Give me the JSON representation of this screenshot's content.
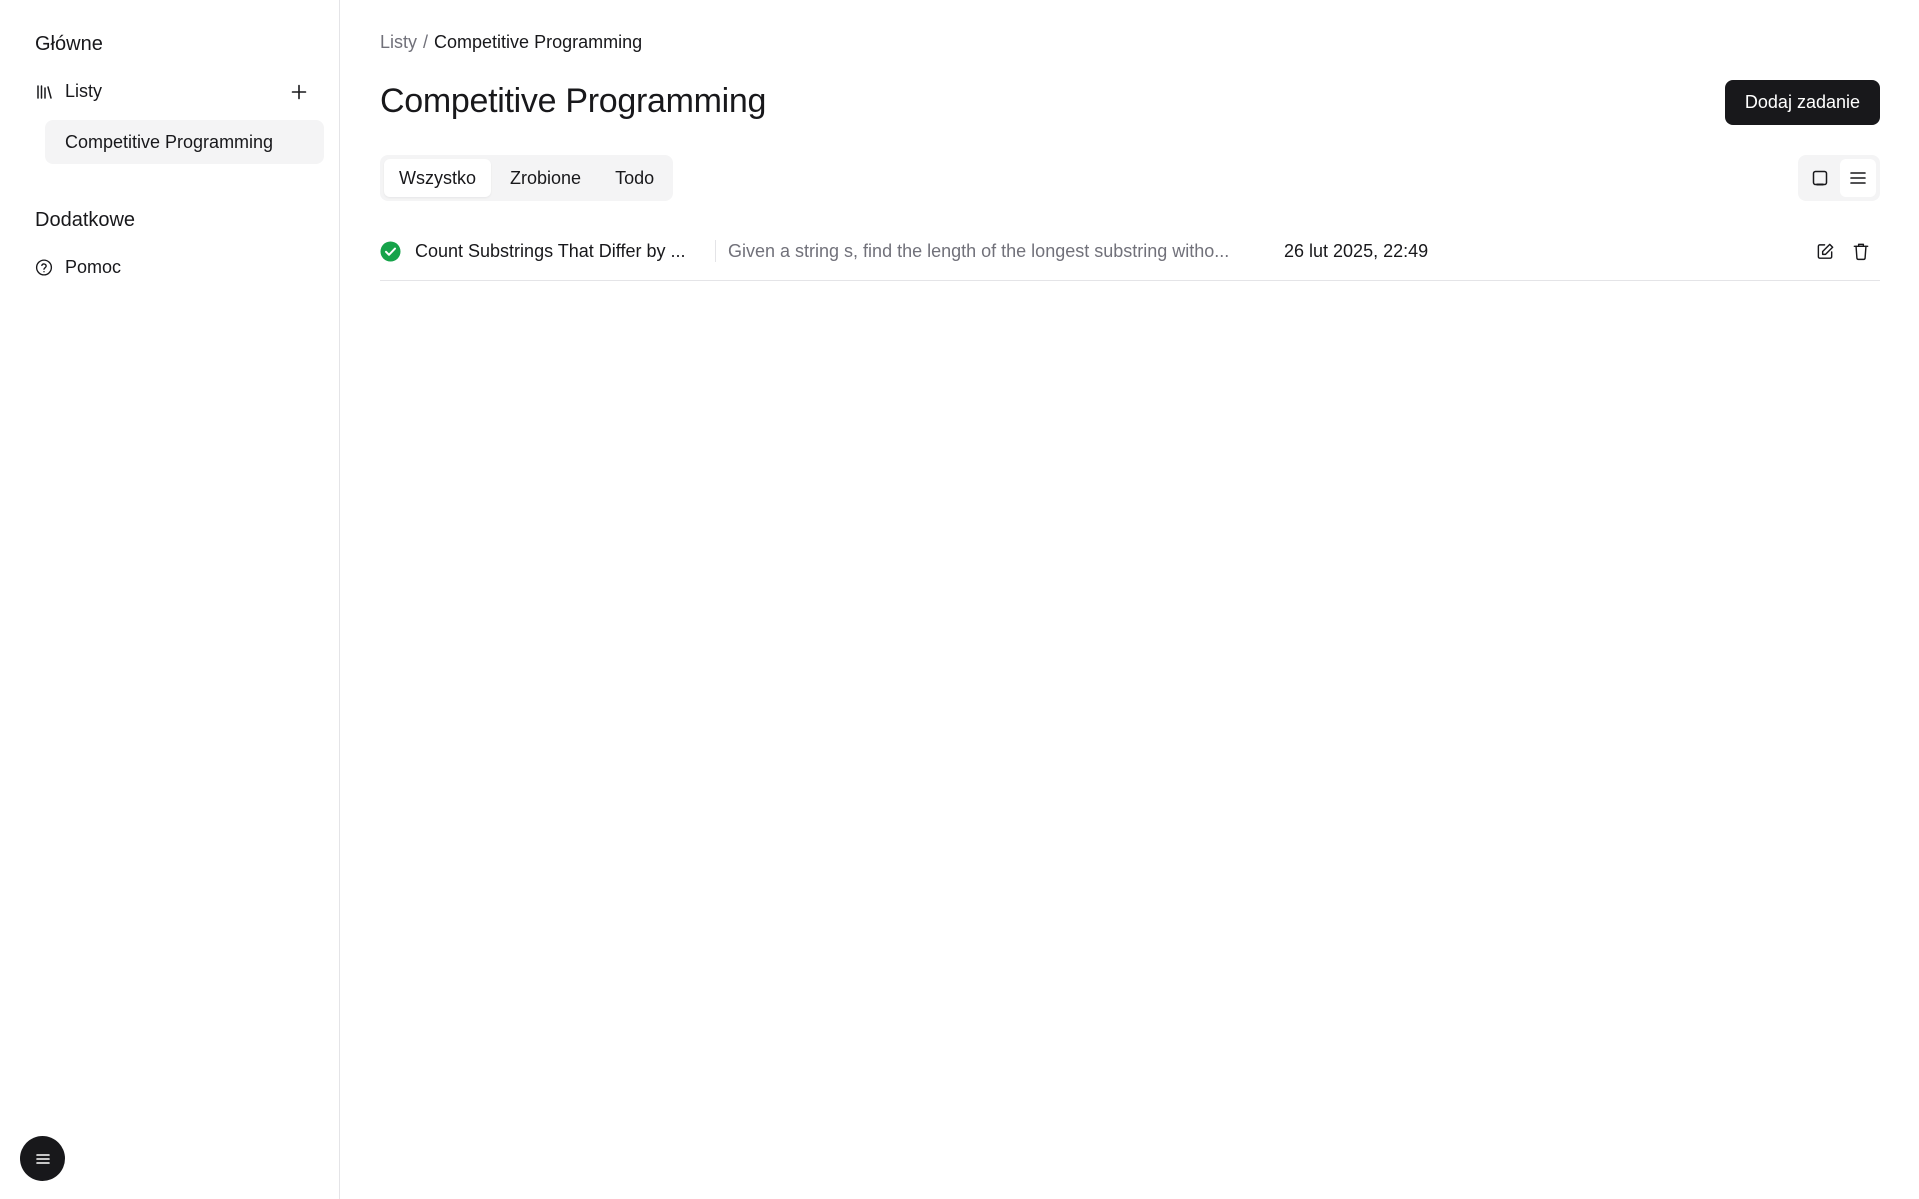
{
  "sidebar": {
    "main_section_title": "Główne",
    "lists_label": "Listy",
    "lists": [
      {
        "label": "Competitive Programming"
      }
    ],
    "extra_section_title": "Dodatkowe",
    "help_label": "Pomoc"
  },
  "breadcrumb": {
    "root": "Listy",
    "separator": "/",
    "current": "Competitive Programming"
  },
  "header": {
    "title": "Competitive Programming",
    "add_task_label": "Dodaj zadanie"
  },
  "filters": {
    "tabs": [
      {
        "label": "Wszystko",
        "active": true
      },
      {
        "label": "Zrobione",
        "active": false
      },
      {
        "label": "Todo",
        "active": false
      }
    ]
  },
  "view_modes": [
    {
      "icon": "card-view-icon",
      "active": false
    },
    {
      "icon": "list-view-icon",
      "active": true
    }
  ],
  "tasks": [
    {
      "status": "done",
      "title": "Count Substrings That Differ by ...",
      "description": "Given a string s, find the length of the longest substring witho...",
      "date": "26 lut 2025, 22:49"
    }
  ],
  "colors": {
    "accent": "#18181b",
    "done_green": "#16a34a",
    "muted_text": "#71717a",
    "border": "#e4e4e7",
    "surface": "#f4f4f5"
  }
}
